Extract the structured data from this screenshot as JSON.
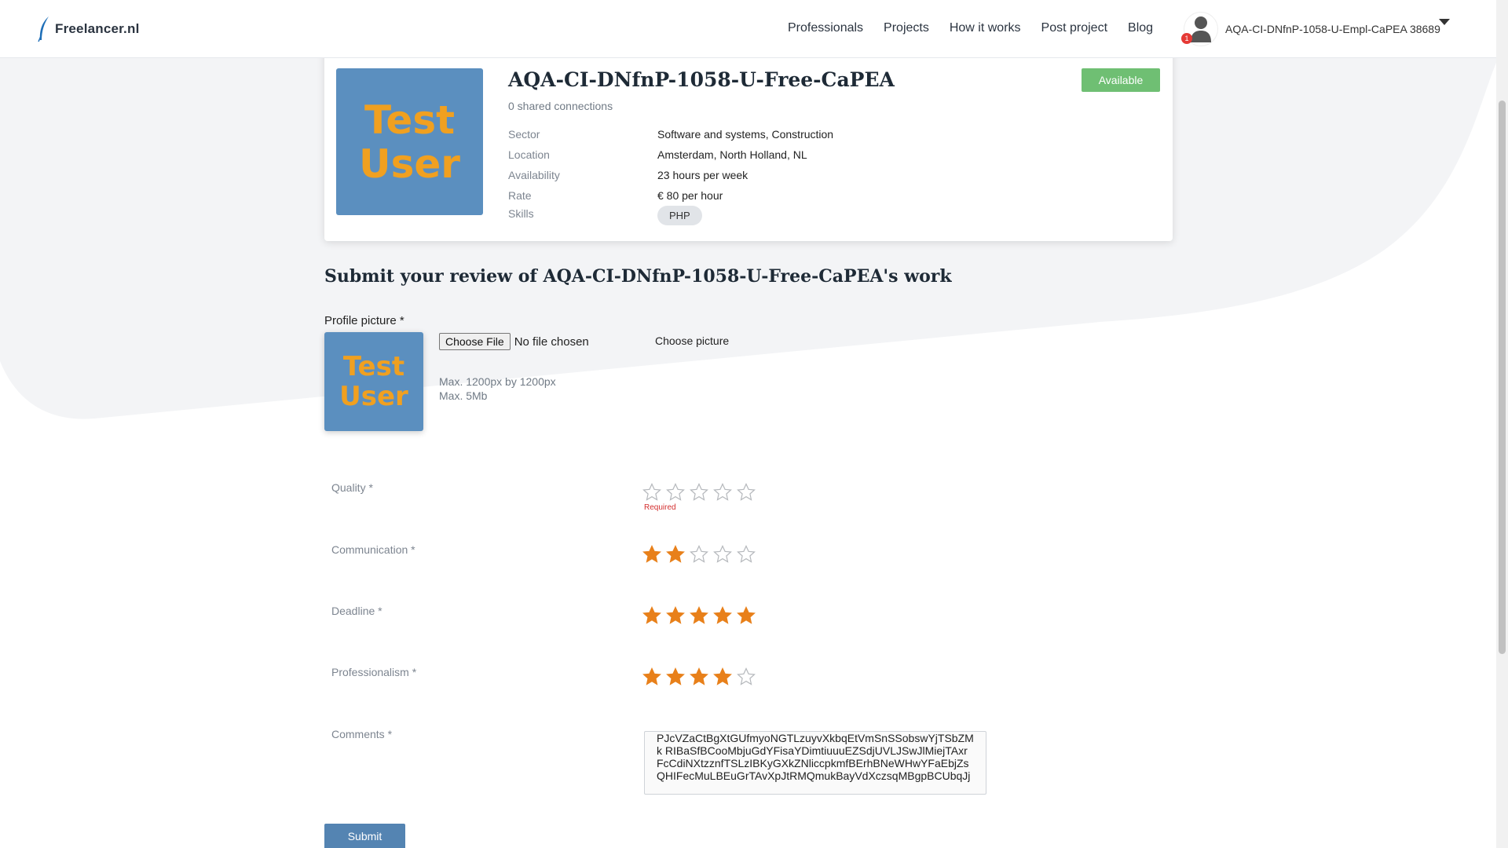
{
  "header": {
    "logo_text": "Freelancer.nl",
    "nav": [
      "Professionals",
      "Projects",
      "How it works",
      "Post project",
      "Blog"
    ],
    "user_name": "AQA-CI-DNfnP-1058-U-Empl-CaPEA 38689",
    "notification_count": "1"
  },
  "profile": {
    "picture_text": [
      "Test",
      "User"
    ],
    "name": "AQA-CI-DNfnP-1058-U-Free-CaPEA",
    "shared_connections": "0 shared connections",
    "status": "Available",
    "status_color": "#6fbf73",
    "info": [
      {
        "label": "Sector",
        "value": "Software and systems, Construction"
      },
      {
        "label": "Location",
        "value": "Amsterdam, North Holland, NL"
      },
      {
        "label": "Availability",
        "value": "23 hours per week"
      },
      {
        "label": "Rate",
        "value": "€ 80 per hour"
      }
    ],
    "skills_label": "Skills",
    "skills": [
      "PHP"
    ]
  },
  "review": {
    "title": "Submit your review of AQA-CI-DNfnP-1058-U-Free-CaPEA's work",
    "picture_label": "Profile picture *",
    "file_button": "Choose File",
    "file_status": "No file chosen",
    "choose_picture": "Choose picture",
    "hint_lines": [
      "Max. 1200px by 1200px",
      "Max. 5Mb"
    ],
    "ratings": [
      {
        "label": "Quality *",
        "stars": 0,
        "max": 5,
        "error": "Required"
      },
      {
        "label": "Communication *",
        "stars": 2,
        "max": 5
      },
      {
        "label": "Deadline *",
        "stars": 5,
        "max": 5
      },
      {
        "label": "Professionalism *",
        "stars": 4,
        "max": 5
      }
    ],
    "comments_label": "Comments *",
    "comments_value": "PJcVZaCtBgXtGUfmyoNGTLzuyvXkbqEtVmSnSSobswYjTSbZMk RIBaSfBCooMbjuGdYFisaYDimtiuuuEZSdjUVLJSwJlMiejTAxrFcCdiNXtzznfTSLzIBKyGXkZNliccpkmfBErhBNeWHwYFaEbjZsQHIFecMuLBEuGrTAvXpJtRMQmukBayVdXczsqMBgpBCUbqJj",
    "submit_label": "Submit",
    "accent_color": "#e8801a"
  }
}
